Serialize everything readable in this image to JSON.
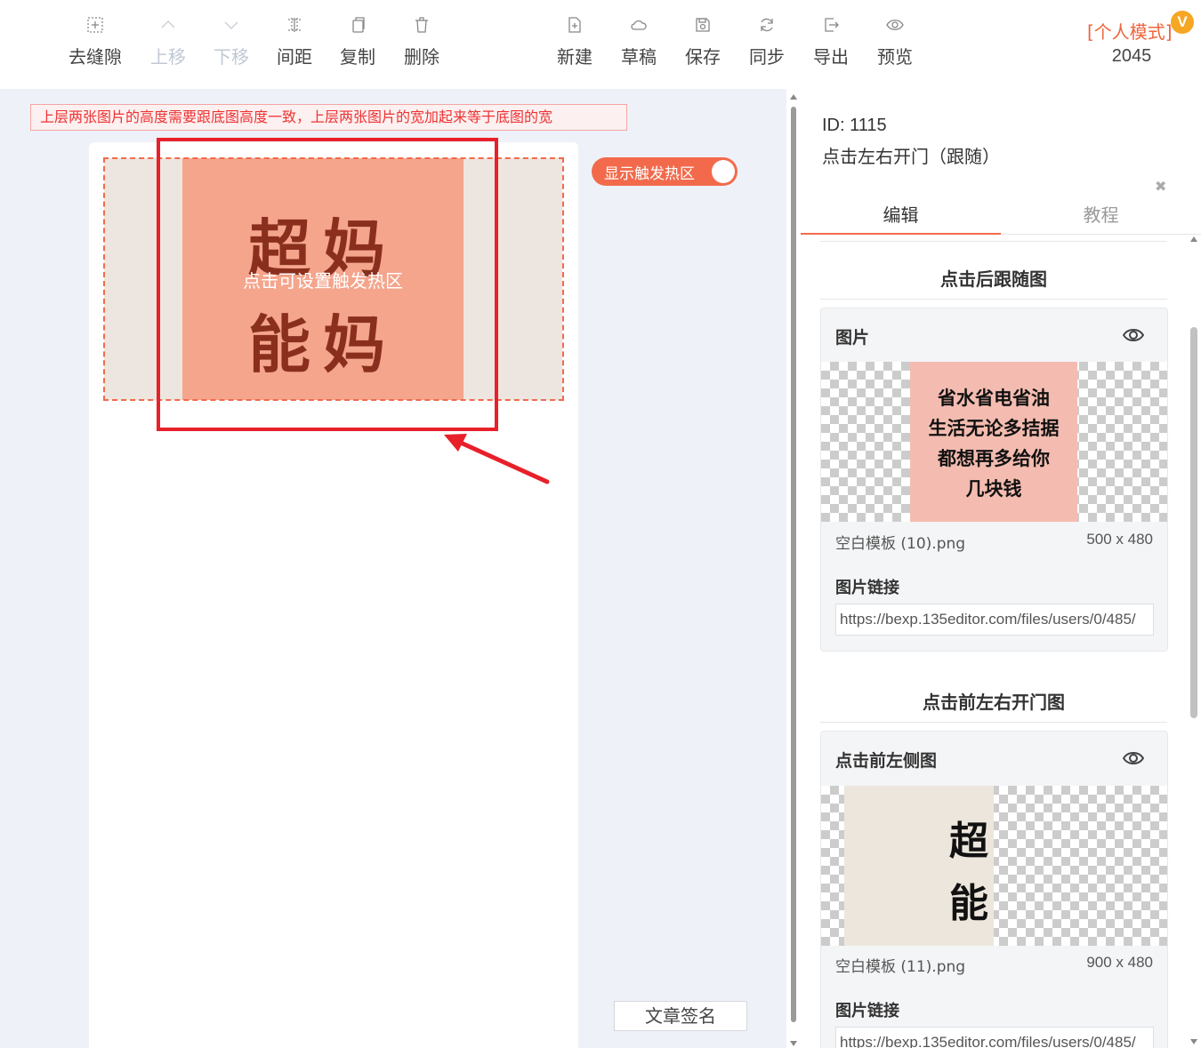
{
  "toolbar": {
    "items": [
      {
        "label": "去缝隙",
        "icon": "gap-icon",
        "disabled": false
      },
      {
        "label": "上移",
        "icon": "chevron-up-icon",
        "disabled": true
      },
      {
        "label": "下移",
        "icon": "chevron-down-icon",
        "disabled": true
      },
      {
        "label": "间距",
        "icon": "spacing-icon",
        "disabled": false
      },
      {
        "label": "复制",
        "icon": "copy-icon",
        "disabled": false
      },
      {
        "label": "删除",
        "icon": "trash-icon",
        "disabled": false
      },
      {
        "label": "新建",
        "icon": "new-file-icon",
        "disabled": false
      },
      {
        "label": "草稿",
        "icon": "cloud-icon",
        "disabled": false
      },
      {
        "label": "保存",
        "icon": "save-icon",
        "disabled": false
      },
      {
        "label": "同步",
        "icon": "sync-icon",
        "disabled": false
      },
      {
        "label": "导出",
        "icon": "export-icon",
        "disabled": false
      },
      {
        "label": "预览",
        "icon": "eye-icon",
        "disabled": false
      }
    ],
    "mode_label": "[个人模式]",
    "vip_badge": "V",
    "count": "2045"
  },
  "editor": {
    "hint": "上层两张图片的高度需要跟底图高度一致，上层两张图片的宽加起来等于底图的宽",
    "banner_line1": "超妈",
    "banner_line2": "能妈",
    "hotzone_text": "点击可设置触发热区",
    "toggle_label": "显示触发热区",
    "toggle_on": true,
    "sign_button": "文章签名"
  },
  "panel": {
    "id_text": "ID: 1115",
    "name": "点击左右开门（跟随）",
    "tabs": [
      {
        "label": "编辑",
        "active": true
      },
      {
        "label": "教程",
        "active": false
      }
    ],
    "section1_title": "点击后跟随图",
    "card1": {
      "title": "图片",
      "image_lines": [
        "省水省电省油",
        "生活无论多拮据",
        "都想再多给你",
        "几块钱"
      ],
      "filename": "空白模板 (10).png",
      "size": "500 x 480",
      "link_label": "图片链接",
      "link_value": "https://bexp.135editor.com/files/users/0/485/"
    },
    "section2_title": "点击前左右开门图",
    "card2": {
      "title": "点击前左侧图",
      "image_chars": [
        "超",
        "能"
      ],
      "filename": "空白模板 (11).png",
      "size": "900 x 480",
      "link_label": "图片链接",
      "link_value": "https://bexp.135editor.com/files/users/0/485/"
    }
  },
  "colors": {
    "accent": "#f26a4b",
    "annotation_red": "#e8202a",
    "banner": "#f4a58c",
    "banner_text": "#8a2f1e"
  }
}
